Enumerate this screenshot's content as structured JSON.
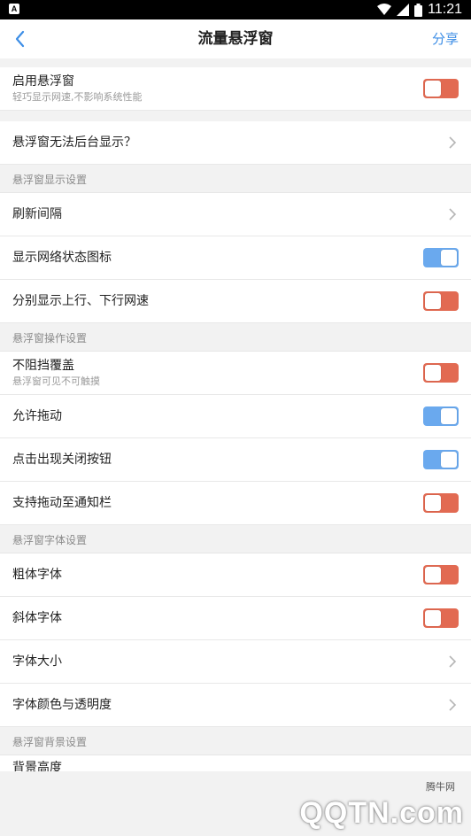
{
  "status_bar": {
    "time": "11:21",
    "left_badge": "A"
  },
  "nav": {
    "title": "流量悬浮窗",
    "share_label": "分享"
  },
  "rows": {
    "enable": {
      "label": "启用悬浮窗",
      "sub": "轻巧显示网速,不影响系统性能",
      "toggle": "off"
    },
    "bg_issue": {
      "label": "悬浮窗无法后台显示？"
    }
  },
  "sections": {
    "display": {
      "header": "悬浮窗显示设置",
      "items": [
        {
          "label": "刷新间隔",
          "kind": "chevron"
        },
        {
          "label": "显示网络状态图标",
          "kind": "toggle",
          "state": "on"
        },
        {
          "label": "分别显示上行、下行网速",
          "kind": "toggle",
          "state": "off"
        }
      ]
    },
    "operation": {
      "header": "悬浮窗操作设置",
      "items": [
        {
          "label": "不阻挡覆盖",
          "sub": "悬浮窗可见不可触摸",
          "kind": "toggle",
          "state": "off"
        },
        {
          "label": "允许拖动",
          "kind": "toggle",
          "state": "on"
        },
        {
          "label": "点击出现关闭按钮",
          "kind": "toggle",
          "state": "on"
        },
        {
          "label": "支持拖动至通知栏",
          "kind": "toggle",
          "state": "off"
        }
      ]
    },
    "font": {
      "header": "悬浮窗字体设置",
      "items": [
        {
          "label": "粗体字体",
          "kind": "toggle",
          "state": "off"
        },
        {
          "label": "斜体字体",
          "kind": "toggle",
          "state": "off"
        },
        {
          "label": "字体大小",
          "kind": "chevron"
        },
        {
          "label": "字体颜色与透明度",
          "kind": "chevron"
        }
      ]
    },
    "background": {
      "header": "悬浮窗背景设置",
      "items": [
        {
          "label": "背景高度",
          "kind": "chevron"
        }
      ]
    }
  },
  "watermark": {
    "cn": "腾牛网",
    "en": "QQTN.com"
  },
  "colors": {
    "accent": "#3d8ee6",
    "toggle_on": "#6aa9ee",
    "toggle_off": "#e26a52"
  },
  "icons": {
    "back": "chevron-left-icon",
    "row_arrow": "chevron-right-icon",
    "wifi": "wifi-icon",
    "signal": "signal-icon",
    "battery": "battery-icon"
  }
}
